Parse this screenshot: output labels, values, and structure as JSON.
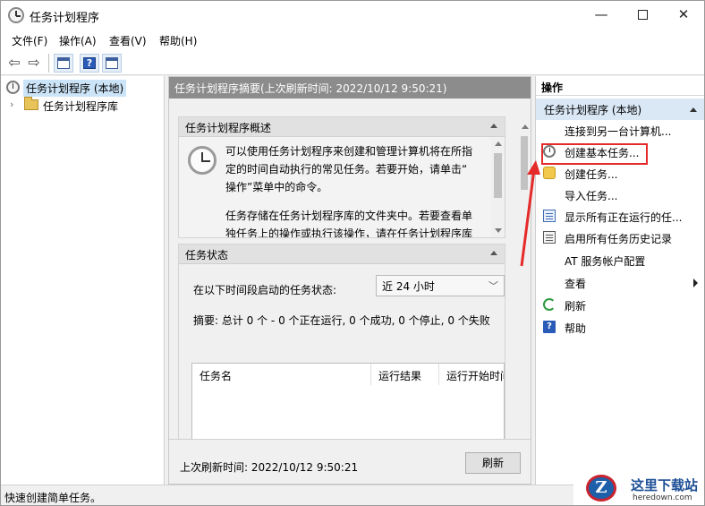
{
  "window": {
    "title": "任务计划程序",
    "minimize_glyph": "—",
    "close_glyph": "✕"
  },
  "menu": {
    "items": [
      "文件(F)",
      "操作(A)",
      "查看(V)",
      "帮助(H)"
    ]
  },
  "toolbar": {
    "back_glyph": "⇦",
    "forward_glyph": "⇨",
    "help_glyph": "?"
  },
  "tree": {
    "root": "任务计划程序 (本地)",
    "library": "任务计划程序库",
    "expander": "›"
  },
  "center": {
    "header": "任务计划程序摘要(上次刷新时间: 2022/10/12 9:50:21)",
    "overview": {
      "title": "任务计划程序概述",
      "para1_line1": "可以使用任务计划程序来创建和管理计算机将在所指",
      "para1_line2": "定的时间自动执行的常见任务。若要开始，请单击“",
      "para1_line3": "操作”菜单中的命令。",
      "para2_line1": "任务存储在任务计划程序库的文件夹中。若要查看单",
      "para2_line2": "独任务上的操作或执行该操作，请在任务计划程序库"
    },
    "status": {
      "title": "任务状态",
      "period_label": "在以下时间段启动的任务状态:",
      "period_value": "近 24 小时",
      "summary": "摘要: 总计 0 个 - 0 个正在运行, 0 个成功, 0 个停止, 0 个失败",
      "columns": [
        "任务名",
        "运行结果",
        "运行开始时间"
      ]
    },
    "footer": {
      "last_refresh": "上次刷新时间: 2022/10/12 9:50:21",
      "refresh_button": "刷新"
    }
  },
  "actions": {
    "title": "操作",
    "section": "任务计划程序 (本地)",
    "items": [
      {
        "label": "连接到另一台计算机...",
        "icon": "none"
      },
      {
        "label": "创建基本任务...",
        "icon": "clock-add-icon",
        "highlighted": true
      },
      {
        "label": "创建任务...",
        "icon": "create-task-icon"
      },
      {
        "label": "导入任务...",
        "icon": "none"
      },
      {
        "label": "显示所有正在运行的任...",
        "icon": "list-icon"
      },
      {
        "label": "启用所有任务历史记录",
        "icon": "history-icon"
      },
      {
        "label": "AT 服务帐户配置",
        "icon": "none"
      },
      {
        "label": "查看",
        "icon": "none",
        "submenu": true
      },
      {
        "label": "刷新",
        "icon": "refresh-icon"
      },
      {
        "label": "帮助",
        "icon": "help-icon"
      }
    ]
  },
  "statusbar": {
    "text": "快速创建简单任务。"
  },
  "watermark": {
    "logo_letter": "Z",
    "name": "这里下载站",
    "domain": "heredown.com"
  },
  "colors": {
    "highlight_red": "#e52a2a",
    "selected_bg": "#cce4f7",
    "header_gray": "#8c8c8c"
  }
}
